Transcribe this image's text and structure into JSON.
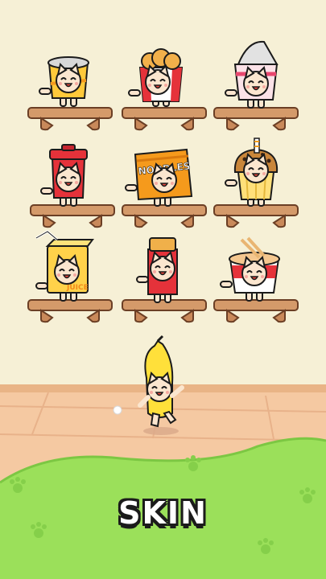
{
  "title": "SKIN",
  "colors": {
    "wall": "#f6f0d6",
    "floor": "#f3c7a0",
    "grass": "#9be05a",
    "shelf": "#d49a6a",
    "outline": "#1b1b1b",
    "cat_body": "#fbe6cf",
    "banana": "#ffe03a"
  },
  "skins": [
    {
      "name": "cup-noodle-yellow",
      "label": ""
    },
    {
      "name": "fried-chicken",
      "label": ""
    },
    {
      "name": "yogurt-cup",
      "label": ""
    },
    {
      "name": "coffee-cup",
      "label": ""
    },
    {
      "name": "noodle-pack",
      "label": "NOODLES"
    },
    {
      "name": "muffin",
      "label": ""
    },
    {
      "name": "juice-box",
      "label": "JUICE"
    },
    {
      "name": "energy-bar",
      "label": ""
    },
    {
      "name": "ramen-bucket",
      "label": ""
    },
    {
      "name": "banana",
      "label": ""
    }
  ]
}
